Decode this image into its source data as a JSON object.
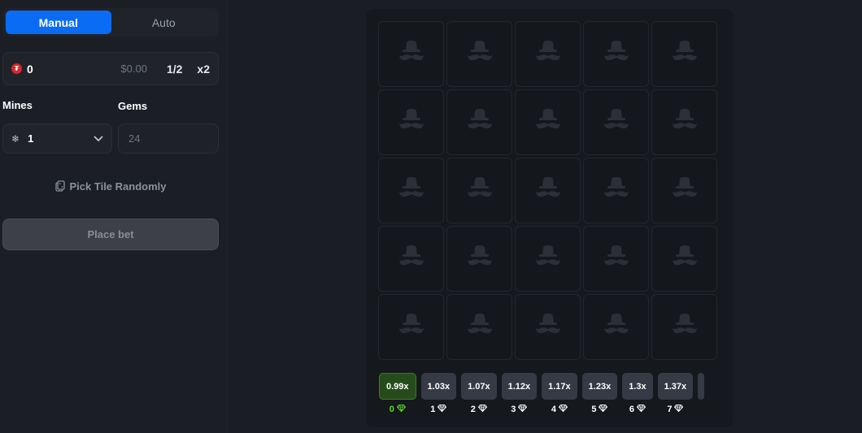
{
  "sidebar": {
    "tabs": [
      {
        "label": "Manual",
        "active": true
      },
      {
        "label": "Auto",
        "active": false
      }
    ],
    "bet": {
      "amount": "0",
      "usd": "$0.00",
      "half_label": "1/2",
      "double_label": "x2"
    },
    "mines": {
      "label": "Mines",
      "value": "1"
    },
    "gems": {
      "label": "Gems",
      "value": "24"
    },
    "pick_random_label": "Pick Tile Randomly",
    "place_bet_label": "Place bet"
  },
  "board": {
    "rows": 5,
    "cols": 5,
    "multipliers": [
      {
        "value": "0.99x",
        "gems": "0",
        "active": true
      },
      {
        "value": "1.03x",
        "gems": "1",
        "active": false
      },
      {
        "value": "1.07x",
        "gems": "2",
        "active": false
      },
      {
        "value": "1.12x",
        "gems": "3",
        "active": false
      },
      {
        "value": "1.17x",
        "gems": "4",
        "active": false
      },
      {
        "value": "1.23x",
        "gems": "5",
        "active": false
      },
      {
        "value": "1.3x",
        "gems": "6",
        "active": false
      },
      {
        "value": "1.37x",
        "gems": "7",
        "active": false
      },
      {
        "value": "",
        "gems": "",
        "active": false
      }
    ]
  },
  "colors": {
    "accent": "#0a6cf5",
    "gem_active": "#5ed626",
    "coin": "#d7262c"
  },
  "icons": {
    "tile": "hat-mustache-icon",
    "gem": "diamond-icon",
    "mines": "snowflake-icon",
    "dropdown": "chevron-down-icon",
    "random": "dice-icon",
    "currency": "coin-icon"
  }
}
